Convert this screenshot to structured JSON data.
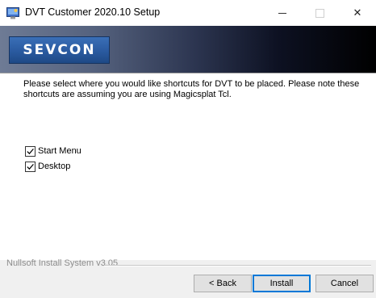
{
  "window": {
    "title": "DVT Customer 2020.10 Setup",
    "minimize_glyph": "—",
    "maximize_glyph": "☐",
    "close_glyph": "✕"
  },
  "banner": {
    "logo_text": "SEVCON"
  },
  "content": {
    "description": "Please select where you would like shortcuts for DVT to be placed. Please note these shortcuts are assuming you are using Magicsplat Tcl.",
    "options": [
      {
        "label": "Start Menu",
        "checked": true
      },
      {
        "label": "Desktop",
        "checked": true
      }
    ]
  },
  "footer": {
    "branding": "Nullsoft Install System v3.05",
    "back_label": "< Back",
    "install_label": "Install",
    "cancel_label": "Cancel"
  },
  "colors": {
    "focus_border": "#0078d7",
    "logo_blue": "#2a5aa0"
  },
  "icons": {
    "app": "installer-app-icon",
    "check": "checkmark-icon"
  }
}
